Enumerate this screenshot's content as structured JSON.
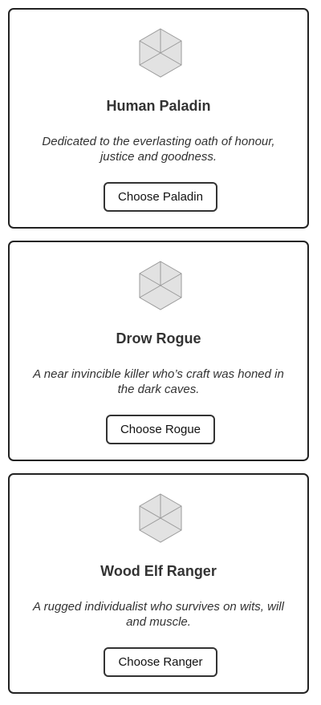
{
  "cards": [
    {
      "icon": "hexagon-placeholder-icon",
      "title": "Human Paladin",
      "description": "Dedicated to the everlasting oath of honour, justice and goodness.",
      "button_label": "Choose Paladin"
    },
    {
      "icon": "hexagon-placeholder-icon",
      "title": "Drow Rogue",
      "description": "A near invincible killer who’s craft was honed in the dark caves.",
      "button_label": "Choose Rogue"
    },
    {
      "icon": "hexagon-placeholder-icon",
      "title": "Wood Elf Ranger",
      "description": "A rugged individualist who survives on wits, will and muscle.",
      "button_label": "Choose Ranger"
    }
  ],
  "colors": {
    "icon_fill": "#e2e2e2",
    "icon_stroke": "#9a9a9a",
    "border": "#222222",
    "text": "#333333"
  }
}
